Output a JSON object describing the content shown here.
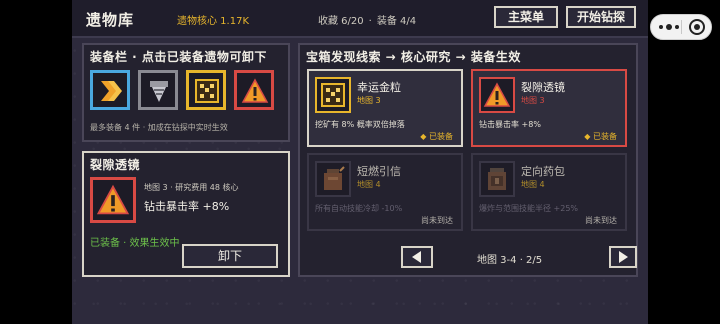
{
  "header": {
    "title": "遗物库",
    "core_text": "遗物核心 1.17K",
    "collected": "收藏 6/20",
    "sep": "·",
    "equipped": "装备 4/4",
    "menu_button": "主菜单",
    "start_button": "开始钻探"
  },
  "equip_panel": {
    "title": "装备栏 · 点击已装备遗物可卸下",
    "note": "最多装备 4 件 · 加成在钻探中实时生效",
    "slots": [
      {
        "name": "chevron-relic",
        "border": "#4aa8e0",
        "icon": "chevron-icon"
      },
      {
        "name": "drill-relic",
        "border": "#8a8a92",
        "icon": "drill-icon"
      },
      {
        "name": "gold-grain-relic",
        "border": "#e8b62c",
        "icon": "gold-grain-icon"
      },
      {
        "name": "fissure-lens-relic",
        "border": "#d84a44",
        "icon": "warning-triangle-icon"
      }
    ]
  },
  "detail_panel": {
    "title": "裂隙透镜",
    "map_cost": "地图 3 · 研究费用 48 核心",
    "effect": "钻击暴击率 +8%",
    "status": "已装备 · 效果生效中",
    "unequip_button": "卸下"
  },
  "collection_panel": {
    "flow_title": "宝箱发现线索 → 核心研究 → 装备生效",
    "cards": [
      {
        "name": "幸运金粒",
        "map": "地图 3",
        "desc": "挖矿有 8% 概率双倍掉落",
        "status": "已装备",
        "state": "selected"
      },
      {
        "name": "裂隙透镜",
        "map": "地图 3",
        "desc": "钻击暴击率 +8%",
        "status": "已装备",
        "state": "equipped"
      },
      {
        "name": "短燃引信",
        "map": "地图 4",
        "desc": "所有自动技能冷却 -10%",
        "status": "尚未到达",
        "state": "locked"
      },
      {
        "name": "定向药包",
        "map": "地图 4",
        "desc": "爆炸与范围技能半径 +25%",
        "status": "尚未到达",
        "state": "locked"
      }
    ],
    "pager_text": "地图 3-4 · 2/5",
    "prev_icon": "left-arrow-icon",
    "next_icon": "right-arrow-icon"
  },
  "colors": {
    "gold": "#e8b62c",
    "red": "#d84a44",
    "blue": "#4aa8e0",
    "green": "#6cc04a"
  },
  "side_controls": {
    "more_icon": "more-dots-icon",
    "target_icon": "target-icon"
  }
}
